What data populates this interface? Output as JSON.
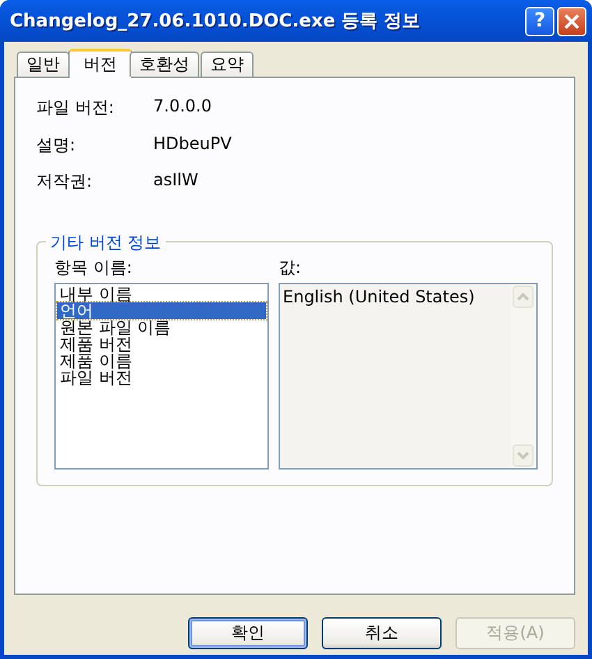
{
  "window": {
    "title": "Changelog_27.06.1010.DOC.exe 등록 정보",
    "help": "?"
  },
  "tabs": [
    {
      "label": "일반",
      "selected": false
    },
    {
      "label": "버전",
      "selected": true
    },
    {
      "label": "호환성",
      "selected": false
    },
    {
      "label": "요약",
      "selected": false
    }
  ],
  "properties": [
    {
      "label": "파일 버전:",
      "value": "7.0.0.0"
    },
    {
      "label": "설명:",
      "value": "HDbeuPV"
    },
    {
      "label": "저작권:",
      "value": "asIlW"
    }
  ],
  "version_group": {
    "title": "기타 버전 정보",
    "names_label": "항목 이름:",
    "value_label": "값:",
    "items": [
      {
        "label": "내부 이름",
        "selected": false
      },
      {
        "label": "언어",
        "selected": true
      },
      {
        "label": "원본 파일 이름",
        "selected": false
      },
      {
        "label": "제품 버전",
        "selected": false
      },
      {
        "label": "제품 이름",
        "selected": false
      },
      {
        "label": "파일 버전",
        "selected": false
      }
    ],
    "value": "English (United States)"
  },
  "buttons": [
    {
      "label": "확인",
      "default": true,
      "disabled": false
    },
    {
      "label": "취소",
      "default": false,
      "disabled": false
    },
    {
      "label": "적용(A)",
      "default": false,
      "disabled": true
    }
  ]
}
